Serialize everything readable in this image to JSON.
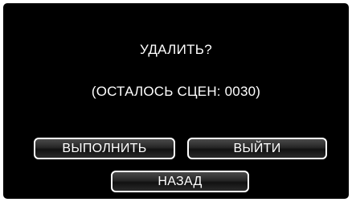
{
  "dialog": {
    "title": "УДАЛИТЬ?",
    "remaining": "(ОСТАЛОСЬ СЦЕН: 0030)"
  },
  "buttons": {
    "execute": "ВЫПОЛНИТЬ",
    "exit": "ВЫЙТИ",
    "back": "НАЗАД"
  },
  "colors": {
    "background": "#000000",
    "text": "#ffffff",
    "button_border": "#ffffff"
  }
}
